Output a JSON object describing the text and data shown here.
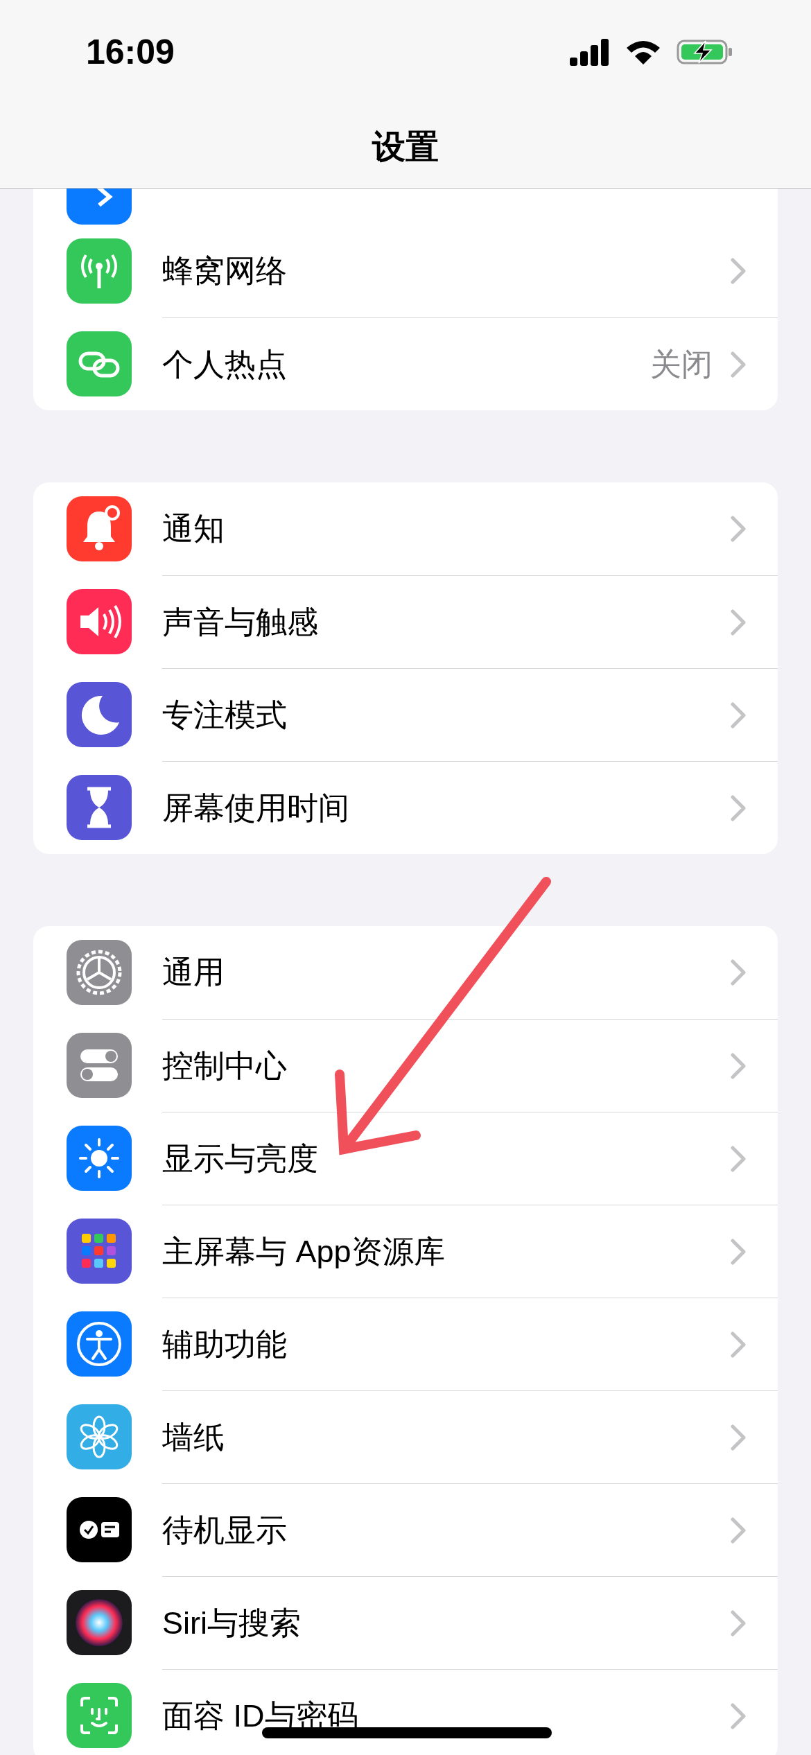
{
  "status_bar": {
    "time": "16:09"
  },
  "nav": {
    "title": "设置"
  },
  "groups": [
    {
      "rows": [
        {
          "kind": "hidden"
        },
        {
          "kind": "link",
          "label": "蜂窝网络"
        },
        {
          "kind": "link",
          "label": "个人热点",
          "value": "关闭"
        }
      ]
    },
    {
      "rows": [
        {
          "kind": "link",
          "label": "通知"
        },
        {
          "kind": "link",
          "label": "声音与触感"
        },
        {
          "kind": "link",
          "label": "专注模式"
        },
        {
          "kind": "link",
          "label": "屏幕使用时间"
        }
      ]
    },
    {
      "rows": [
        {
          "kind": "link",
          "label": "通用"
        },
        {
          "kind": "link",
          "label": "控制中心"
        },
        {
          "kind": "link",
          "label": "显示与亮度"
        },
        {
          "kind": "link",
          "label": "主屏幕与 App资源库"
        },
        {
          "kind": "link",
          "label": "辅助功能"
        },
        {
          "kind": "link",
          "label": "墙纸"
        },
        {
          "kind": "link",
          "label": "待机显示"
        },
        {
          "kind": "link",
          "label": "Siri与搜索"
        },
        {
          "kind": "link",
          "label": "面容 ID与密码"
        }
      ]
    }
  ]
}
